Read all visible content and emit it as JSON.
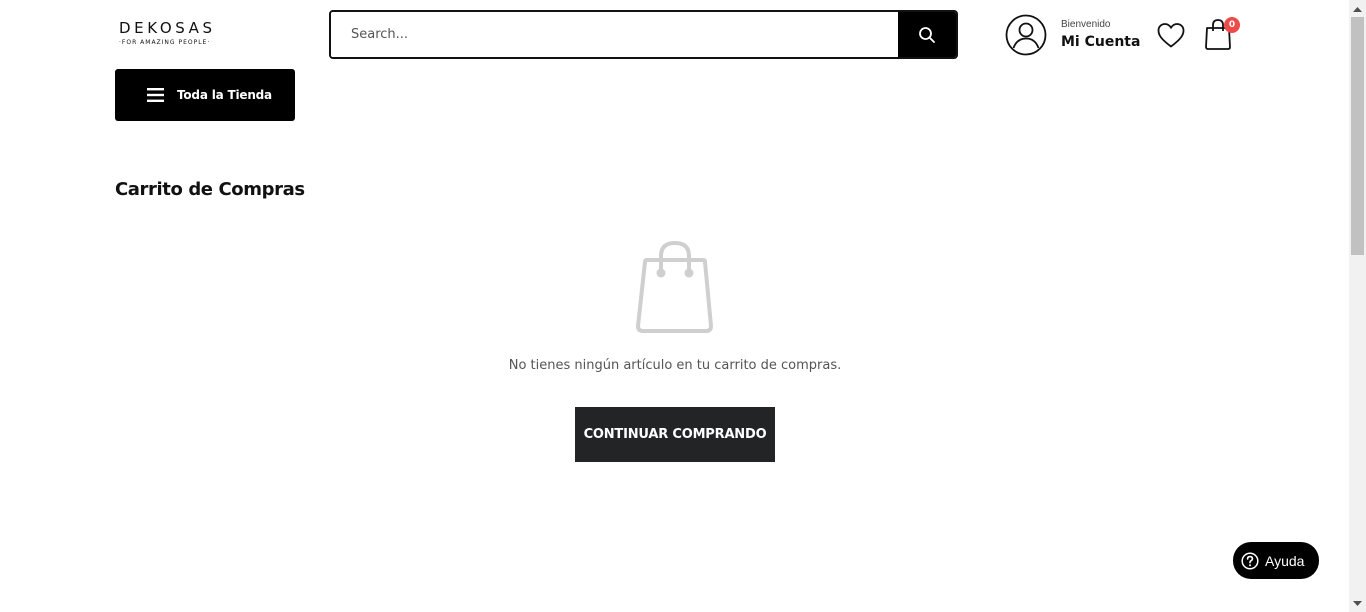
{
  "header": {
    "logo": {
      "wordmark": "DEKOSAS",
      "tagline": "·FOR AMAZING PEOPLE·"
    },
    "search": {
      "placeholder": "Search..."
    },
    "account": {
      "greeting": "Bienvenido",
      "label": "Mi Cuenta"
    },
    "cart": {
      "count": "0"
    }
  },
  "nav": {
    "store_button_label": "Toda la Tienda"
  },
  "main": {
    "title": "Carrito de Compras",
    "empty_message": "No tienes ningún artículo en tu carrito de compras.",
    "continue_label": "CONTINUAR COMPRANDO"
  },
  "help": {
    "label": "Ayuda"
  },
  "icons": {
    "search": "search-icon",
    "account": "user-circle-icon",
    "wishlist": "heart-icon",
    "cart": "shopping-bag-icon",
    "menu": "hamburger-menu-icon",
    "empty_cart": "shopping-bag-icon",
    "help": "question-circle-icon"
  },
  "colors": {
    "primary": "#000000",
    "button_dark": "#222426",
    "badge": "#ee4a4a",
    "empty_icon": "#cccccc"
  }
}
